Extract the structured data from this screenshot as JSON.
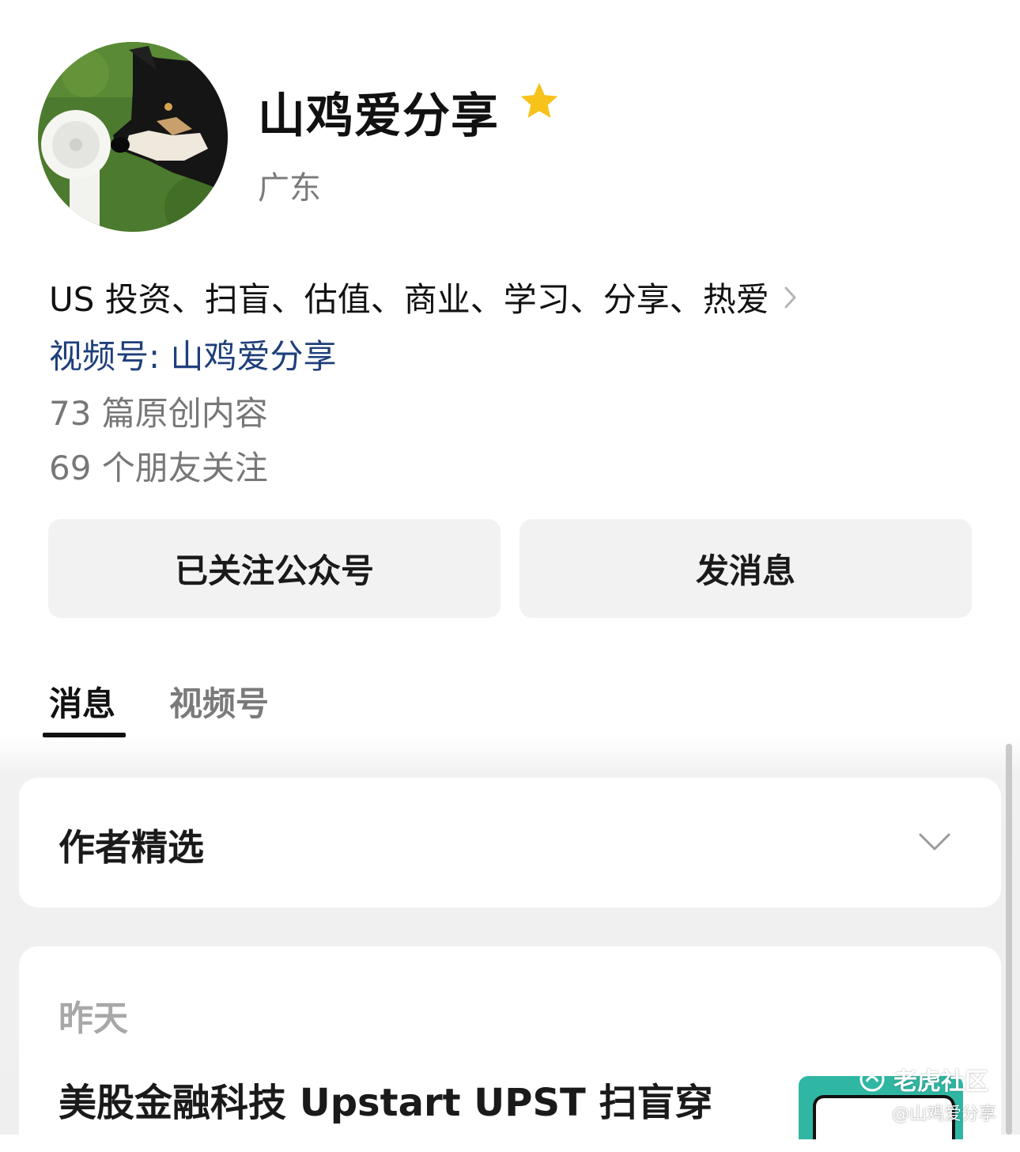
{
  "profile": {
    "name": "山鸡爱分享",
    "region": "广东",
    "intro": "US 投资、扫盲、估值、商业、学习、分享、热爱",
    "channel": "视频号: 山鸡爱分享",
    "original_count": "73 篇原创内容",
    "followers": "69 个朋友关注",
    "star_color": "#f7c21a"
  },
  "actions": {
    "followed_label": "已关注公众号",
    "message_label": "发消息"
  },
  "tabs": [
    {
      "label": "消息",
      "active": true
    },
    {
      "label": "视频号",
      "active": false
    }
  ],
  "featured": {
    "title": "作者精选"
  },
  "feed": {
    "date": "昨天",
    "article_title": "美股金融科技 Upstart UPST 扫盲穿"
  },
  "watermark": {
    "brand": "老虎社区",
    "handle": "@山鸡爱分享"
  },
  "icons": {
    "star": "star-icon",
    "chevron_right": "chevron-right-icon",
    "chevron_down": "chevron-down-icon",
    "brand_logo": "tiger-logo-icon"
  }
}
